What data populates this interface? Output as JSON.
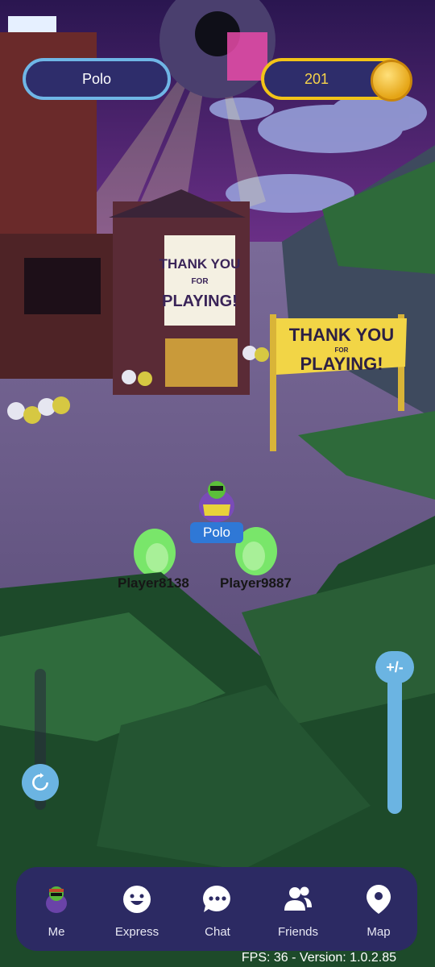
{
  "hud": {
    "player_name": "Polo",
    "coins": "201"
  },
  "scene": {
    "banner_sign_text": [
      "THANK YOU",
      "FOR",
      "PLAYING!"
    ],
    "board_sign_text": [
      "THANK YOU",
      "FOR",
      "PLAYING!"
    ],
    "player_tag": "Polo",
    "other_players": [
      "Player8138",
      "Player9887"
    ]
  },
  "controls": {
    "zoom_label": "+/-"
  },
  "nav": {
    "items": [
      {
        "label": "Me",
        "icon": "penguin-avatar-icon"
      },
      {
        "label": "Express",
        "icon": "smiley-icon"
      },
      {
        "label": "Chat",
        "icon": "chat-bubble-icon"
      },
      {
        "label": "Friends",
        "icon": "friends-icon"
      },
      {
        "label": "Map",
        "icon": "map-pin-icon"
      }
    ]
  },
  "status": {
    "fps_text": "FPS: 36 - Version: 1.0.2.85"
  },
  "colors": {
    "sky": "#3b1d5e",
    "ground": "#5a4a78",
    "hud_accent_blue": "#6fb6e6",
    "coin_gold": "#f2c318",
    "navbar": "#2c2a63"
  }
}
